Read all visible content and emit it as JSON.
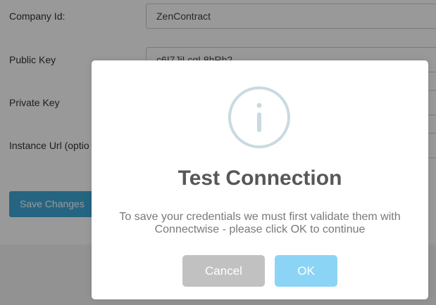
{
  "form": {
    "fields": [
      {
        "label": "Company Id:",
        "value": "ZenContract"
      },
      {
        "label": "Public Key",
        "value": "c6I7JiLcgL8hRh2"
      },
      {
        "label": "Private Key",
        "value": ""
      },
      {
        "label": "Instance Url (optio",
        "value": ""
      }
    ],
    "save_label": "Save Changes"
  },
  "modal": {
    "icon": "info-icon",
    "title": "Test Connection",
    "message_line1": "To save your credentials we must first validate them with",
    "message_line2": "Connectwise - please click OK to continue",
    "cancel_label": "Cancel",
    "ok_label": "OK"
  },
  "colors": {
    "save_button": "#3fa9d8",
    "ok_button": "#8cd4f5",
    "cancel_button": "#c1c1c1",
    "icon_ring": "#c9dae1",
    "title": "#575757",
    "message": "#797979"
  }
}
